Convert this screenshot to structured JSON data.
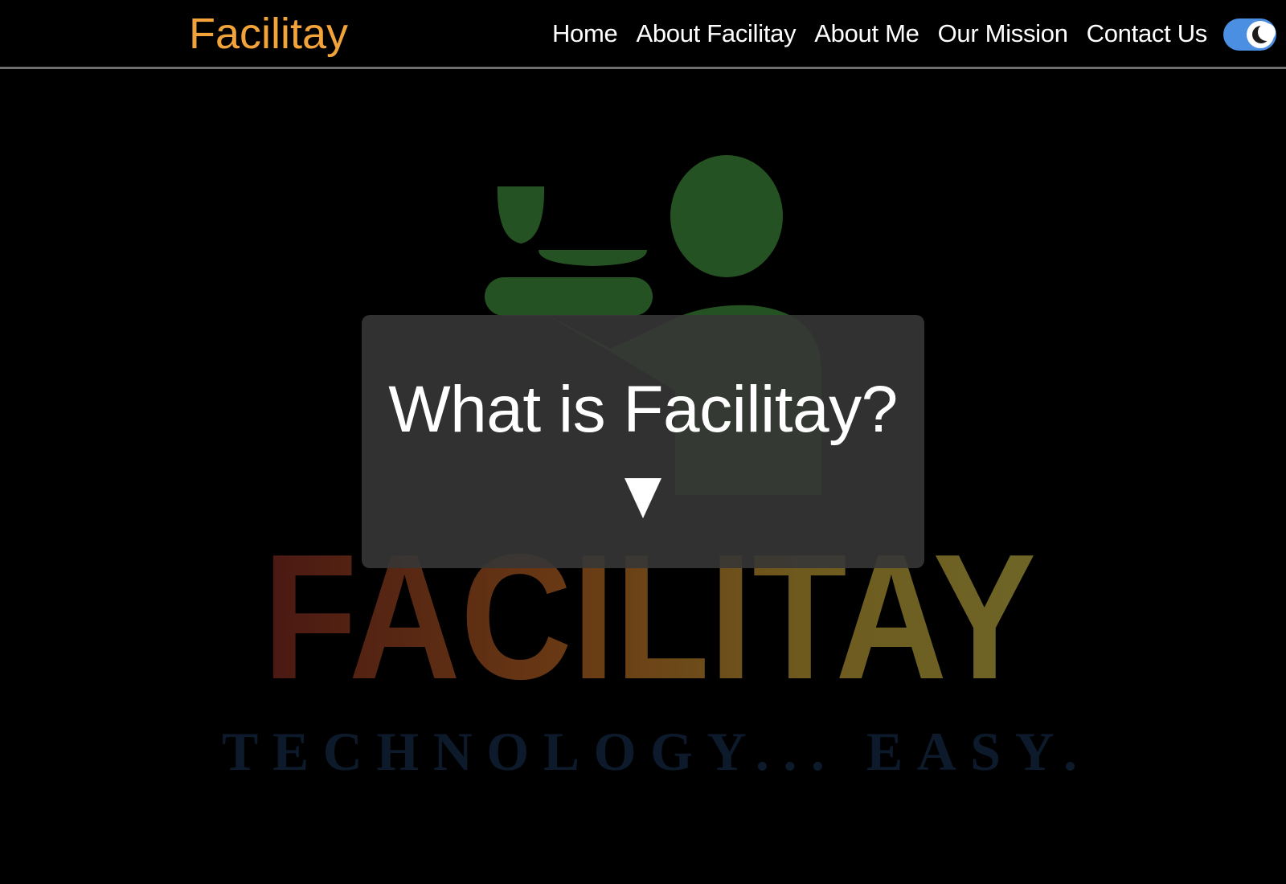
{
  "brand": {
    "name": "Facilitay",
    "color": "#f2a33a"
  },
  "nav": {
    "items": [
      {
        "label": "Home"
      },
      {
        "label": "About Facilitay"
      },
      {
        "label": "About Me"
      },
      {
        "label": "Our Mission"
      },
      {
        "label": "Contact Us"
      }
    ],
    "theme_toggle": {
      "icon": "moon-icon",
      "state": "dark",
      "color": "#4a8fe2"
    }
  },
  "hero": {
    "logo": {
      "wordmark": "FACILITAY",
      "tagline": "TECHNOLOGY... EASY."
    },
    "card": {
      "title": "What is Facilitay?",
      "arrow_icon": "triangle-down-icon"
    }
  }
}
